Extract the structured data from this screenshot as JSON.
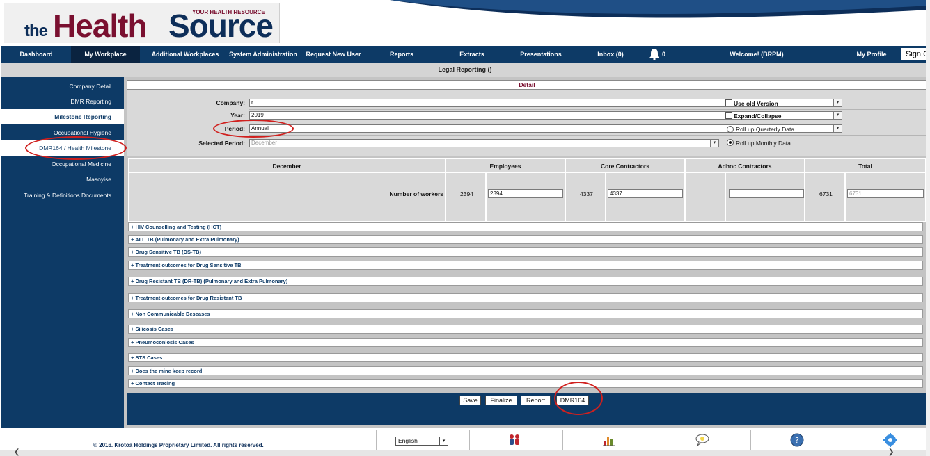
{
  "brand": {
    "the": "the",
    "health": "Health",
    "source": "Source",
    "tagline": "YOUR HEALTH RESOURCE"
  },
  "nav": {
    "items": [
      {
        "label": "Dashboard"
      },
      {
        "label": "My Workplace"
      },
      {
        "label": "Additional Workplaces"
      },
      {
        "label": "System Administration"
      },
      {
        "label": "Request New User"
      },
      {
        "label": "Reports"
      },
      {
        "label": "Extracts"
      },
      {
        "label": "Presentations"
      },
      {
        "label": "Inbox (0)"
      }
    ],
    "notification_count": "0",
    "welcome": "Welcome! (BRPM)",
    "profile": "My Profile",
    "signout": "Sign Out"
  },
  "page_title": "Legal Reporting ()",
  "sidebar": {
    "items": [
      {
        "label": "Company Detail"
      },
      {
        "label": "DMR Reporting"
      },
      {
        "label": "Milestone Reporting"
      },
      {
        "label": "Occupational Hygiene"
      },
      {
        "label": "DMR164 / Health Milestone"
      },
      {
        "label": "Occupational Medicine"
      },
      {
        "label": "Masoyise"
      },
      {
        "label": "Training & Definitions Documents"
      }
    ]
  },
  "detail_title": "Detail",
  "form": {
    "company_label": "Company:",
    "company_value": "r",
    "year_label": "Year:",
    "year_value": "2019",
    "period_label": "Period:",
    "period_value": "Annual",
    "selected_period_label": "Selected Period:",
    "selected_period_value": "December",
    "use_old_version": "Use old Version",
    "expand_collapse": "Expand/Collapse",
    "rollup_quarterly": "Roll up Quarterly Data",
    "rollup_monthly": "Roll up Monthly Data",
    "rollup_selected": "monthly"
  },
  "workers_table": {
    "headers": [
      "December",
      "Employees",
      "Core Contractors",
      "Adhoc Contractors",
      "Total"
    ],
    "row_label": "Number of workers",
    "employees_prev": "2394",
    "employees_value": "2394",
    "core_prev": "4337",
    "core_value": "4337",
    "adhoc_value": "",
    "total_prev": "6731",
    "total_value": "6731"
  },
  "sections": [
    "+ HIV Counselling and Testing (HCT)",
    "+ ALL TB (Pulmonary and Extra Pulmonary)",
    "+ Drug Sensitive TB (DS-TB)",
    "+ Treatment outcomes for Drug Sensitive TB",
    "+ Drug Resistant TB (DR-TB) (Pulmonary and Extra Pulmonary)",
    "+ Treatment outcomes for Drug Resistant TB",
    "+ Non Communicable Deseases",
    "+ Silicosis Cases",
    "+ Pneumoconiosis Cases",
    "+ STS Cases",
    "+ Does the mine keep record",
    "+ Contact Tracing"
  ],
  "actions": {
    "save": "Save",
    "finalize": "Finalize",
    "report": "Report",
    "dmr164": "DMR164"
  },
  "footer": {
    "copyright": "© 2016. Krotoa Holdings Proprietary Limited. All rights reserved.",
    "language": "English",
    "icons": [
      "people-icon",
      "chart-icon",
      "idea-bubble-icon",
      "help-icon",
      "settings-badge-icon"
    ]
  },
  "colors": {
    "navy": "#0d3a66",
    "maroon": "#7a1030",
    "annotation_red": "#d0201e"
  }
}
